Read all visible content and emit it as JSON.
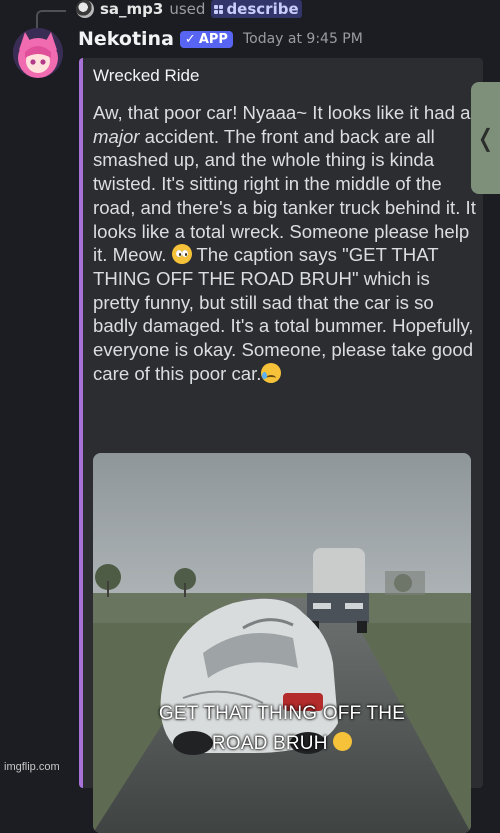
{
  "reply": {
    "username": "sa_mp3",
    "used_text": "used",
    "command": "describe"
  },
  "message": {
    "bot_name": "Nekotina",
    "badge_label": "APP",
    "badge_check_icon": "check-icon",
    "timestamp": "Today at 9:45 PM"
  },
  "embed": {
    "accent_color": "#a873d8",
    "title": "Wrecked Ride",
    "description": {
      "part1": "Aw, that poor car!  Nyaaa~  It looks like it had a ",
      "emphasis": "major",
      "part2": " accident.  The front and back are all smashed up, and the whole thing is kinda twisted.  It's sitting right in the middle of the road, and there's a big tanker truck behind it.  It looks like a total wreck. Someone please help it.  Meow. ",
      "emoji1": "pleading-face-emoji",
      "part3": "  The caption says \"GET THAT THING OFF THE ROAD BRUH\" which is pretty funny, but still sad that the car is so badly damaged.  It's a total bummer.  Hopefully, everyone is okay. Someone, please take good care of this poor car.",
      "emoji2": "sad-but-relieved-face-emoji"
    },
    "image": {
      "caption_line1": "GET THAT THING OFF THE",
      "caption_line2": "ROAD BRUH",
      "caption_emoji": "loudly-crying-face-emoji"
    }
  },
  "side_tab": {
    "glyph": "❬"
  },
  "watermark": "imgflip.com"
}
